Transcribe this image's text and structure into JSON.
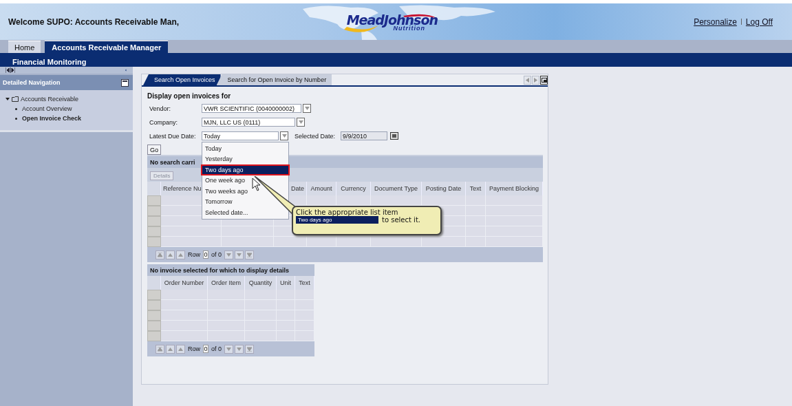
{
  "header": {
    "welcome": "Welcome SUPO: Accounts Receivable Man,",
    "logo": {
      "word_1": "Mead",
      "word_2": "Johnson",
      "tagline": "Nutrition"
    },
    "links": [
      "Personalize",
      "Log Off"
    ]
  },
  "top_tabs": [
    {
      "label": "Home",
      "selected": false
    },
    {
      "label": "Accounts Receivable Manager",
      "selected": true
    }
  ],
  "sub_nav": {
    "label": "Financial Monitoring"
  },
  "sidebar": {
    "title": "Detailed Navigation",
    "items": [
      {
        "label": "Accounts Receivable",
        "expanded": true,
        "children": [
          {
            "label": "Account Overview",
            "selected": false
          },
          {
            "label": "Open Invoice Check",
            "selected": true
          }
        ]
      }
    ]
  },
  "panel_tabs": [
    {
      "label": "Search Open Invoices",
      "selected": true
    },
    {
      "label": "Search for Open Invoice by Number",
      "selected": false
    }
  ],
  "form": {
    "title": "Display open invoices for",
    "fields": [
      {
        "label": "Vendor:",
        "value": "VWR SCIENTIFIC (0040000002)"
      },
      {
        "label": "Company:",
        "value": "MJN, LLC US (0111)"
      },
      {
        "label": "Latest Due Date:",
        "value": "Today"
      }
    ],
    "selected_date": {
      "label": "Selected Date:",
      "value": "9/9/2010"
    },
    "go_button": "Go"
  },
  "dropdown": {
    "items": [
      {
        "label": "Today",
        "selected": false
      },
      {
        "label": "Yesterday",
        "selected": false
      },
      {
        "label": "Two days ago",
        "selected": true
      },
      {
        "label": "One week ago",
        "selected": false
      },
      {
        "label": "Two weeks ago",
        "selected": false
      },
      {
        "label": "Tomorrow",
        "selected": false
      },
      {
        "label": "Selected date...",
        "selected": false
      }
    ]
  },
  "results": {
    "title": "No search carri",
    "details_button": "Details",
    "columns": [
      {
        "kind": "text",
        "label": "Reference Nu"
      },
      {
        "kind": "covered"
      },
      {
        "kind": "text",
        "label": "Date"
      },
      {
        "kind": "text",
        "label": "Amount"
      },
      {
        "kind": "text",
        "label": "Currency"
      },
      {
        "kind": "text",
        "label": "Document Type"
      },
      {
        "kind": "text",
        "label": "Posting Date"
      },
      {
        "kind": "text",
        "label": "Text"
      },
      {
        "kind": "text",
        "label": "Payment Blocking"
      }
    ],
    "pager": {
      "label": "Row",
      "value": "0",
      "total": "of 0"
    }
  },
  "details": {
    "title": "No invoice selected for which to display details",
    "columns": [
      {
        "kind": "text",
        "label": "Order Number"
      },
      {
        "kind": "text",
        "label": "Order Item"
      },
      {
        "kind": "text",
        "label": "Quantity"
      },
      {
        "kind": "text",
        "label": "Unit"
      },
      {
        "kind": "text",
        "label": "Text"
      }
    ],
    "pager": {
      "label": "Row",
      "value": "0",
      "total": "of 0"
    }
  },
  "tooltip": {
    "text": "Click the appropriate list item",
    "highlight": "Two days ago",
    "suffix": "to select it."
  }
}
